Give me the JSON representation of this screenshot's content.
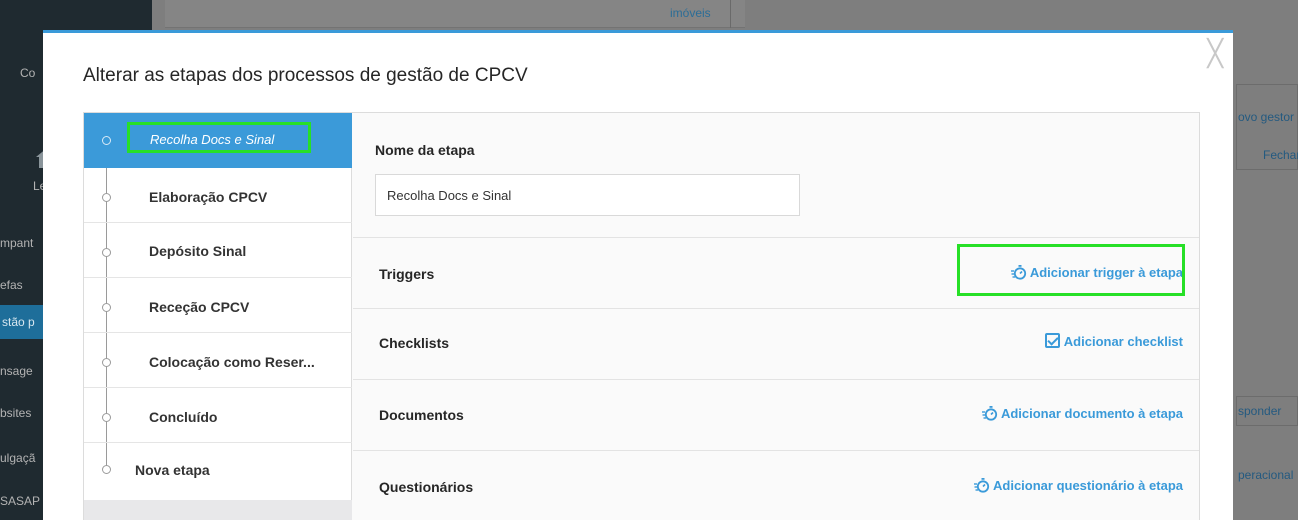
{
  "background": {
    "top_tab": "imóveis",
    "sidebar_items": [
      {
        "label": "Co"
      },
      {
        "label": "Le"
      },
      {
        "label": "mpant"
      },
      {
        "label": "efas"
      },
      {
        "label": "stão p"
      },
      {
        "label": "nsage"
      },
      {
        "label": "bsites"
      },
      {
        "label": "ulgaçã"
      },
      {
        "label": "SASAP"
      }
    ],
    "right_items": [
      {
        "label": "ovo gestor"
      },
      {
        "label": "Fechar"
      },
      {
        "label": "sponder"
      },
      {
        "label": "peracional"
      }
    ]
  },
  "modal": {
    "title": "Alterar as etapas dos processos de gestão de CPCV",
    "close_glyph": "╳",
    "steps": [
      {
        "label": "Recolha Docs e Sinal",
        "active": true
      },
      {
        "label": "Elaboração CPCV"
      },
      {
        "label": "Depósito Sinal"
      },
      {
        "label": "Receção CPCV"
      },
      {
        "label": "Colocação como Reser..."
      },
      {
        "label": "Concluído"
      },
      {
        "label": "Nova etapa",
        "new": true
      }
    ],
    "details": {
      "name_label": "Nome da etapa",
      "name_value": "Recolha Docs e Sinal",
      "sections": [
        {
          "title": "Triggers",
          "action": "Adicionar trigger à etapa",
          "icon": "timer-add-icon"
        },
        {
          "title": "Checklists",
          "action": "Adicionar checklist",
          "icon": "checkbox-icon"
        },
        {
          "title": "Documentos",
          "action": "Adicionar documento à etapa",
          "icon": "timer-add-icon"
        },
        {
          "title": "Questionários",
          "action": "Adicionar questionário à etapa",
          "icon": "timer-add-icon"
        }
      ]
    }
  },
  "colors": {
    "accent": "#3a9ad9",
    "highlight": "#27e027",
    "overlay": "#7b7b7b"
  }
}
